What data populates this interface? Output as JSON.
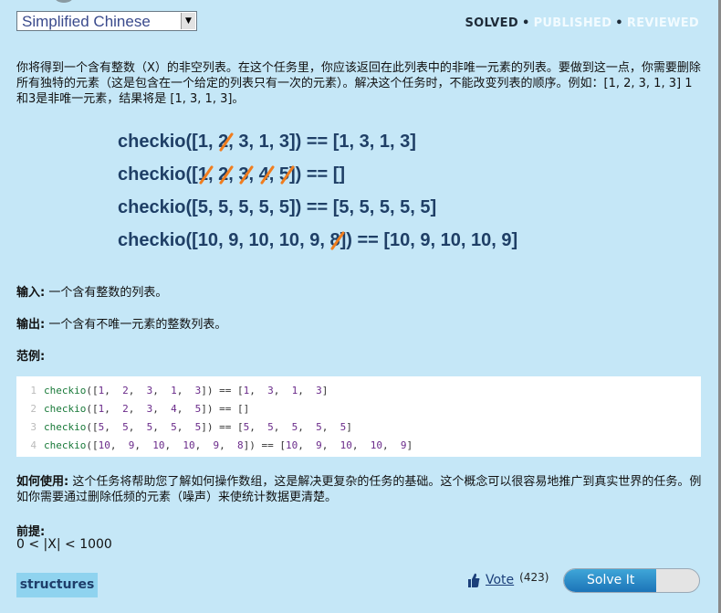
{
  "language_select": {
    "value": "Simplified Chinese"
  },
  "status": {
    "solved": "SOLVED",
    "published": "PUBLISHED",
    "reviewed": "REVIEWED",
    "separator": "•"
  },
  "description": "你将得到一个含有整数（X）的非空列表。在这个任务里，你应该返回在此列表中的非唯一元素的列表。要做到这一点，你需要删除所有独特的元素（这是包含在一个给定的列表只有一次的元素）。解决这个任务时，不能改变列表的顺序。例如：[1, 2, 3, 1, 3] 1和3是非唯一元素，结果将是 [1, 3, 1, 3]。",
  "examples": [
    {
      "args": [
        "1",
        "2",
        "3",
        "1",
        "3"
      ],
      "struck": [
        1
      ],
      "result": "[1, 3, 1, 3]"
    },
    {
      "args": [
        "1",
        "2",
        "3",
        "4",
        "5"
      ],
      "struck": [
        0,
        1,
        2,
        3,
        4
      ],
      "result": "[]"
    },
    {
      "args": [
        "5",
        "5",
        "5",
        "5",
        "5"
      ],
      "struck": [],
      "result": "[5, 5, 5, 5, 5]"
    },
    {
      "args": [
        "10",
        "9",
        "10",
        "10",
        "9",
        "8"
      ],
      "struck": [
        5
      ],
      "result": "[10, 9, 10, 10, 9]"
    }
  ],
  "input": {
    "label": "输入:",
    "text": "一个含有整数的列表。"
  },
  "output": {
    "label": "输出:",
    "text": "一个含有不唯一元素的整数列表。"
  },
  "example_section": {
    "label": "范例:"
  },
  "code_lines": [
    {
      "num": "1",
      "args": [
        "1",
        "2",
        "3",
        "1",
        "3"
      ],
      "result": [
        "1",
        "3",
        "1",
        "3"
      ]
    },
    {
      "num": "2",
      "args": [
        "1",
        "2",
        "3",
        "4",
        "5"
      ],
      "result": []
    },
    {
      "num": "3",
      "args": [
        "5",
        "5",
        "5",
        "5",
        "5"
      ],
      "result": [
        "5",
        "5",
        "5",
        "5",
        "5"
      ]
    },
    {
      "num": "4",
      "args": [
        "10",
        "9",
        "10",
        "10",
        "9",
        "8"
      ],
      "result": [
        "10",
        "9",
        "10",
        "10",
        "9"
      ]
    }
  ],
  "how_to_use": {
    "label": "如何使用:",
    "text": "这个任务将帮助您了解如何操作数组，这是解决更复杂的任务的基础。这个概念可以很容易地推广到真实世界的任务。例如你需要通过删除低频的元素（噪声）来使统计数据更清楚。"
  },
  "precondition": {
    "label": "前提:",
    "text": "0 < |X| < 1000"
  },
  "tag": "structures",
  "vote": {
    "label": "Vote",
    "count": "(423)"
  },
  "solve_button": {
    "label": "Solve It",
    "progress": 0.68
  },
  "colors": {
    "background": "#c5e7f7",
    "strike": "#f07d1e",
    "example_text": "#1f3f66",
    "button": "#1c74b8"
  }
}
